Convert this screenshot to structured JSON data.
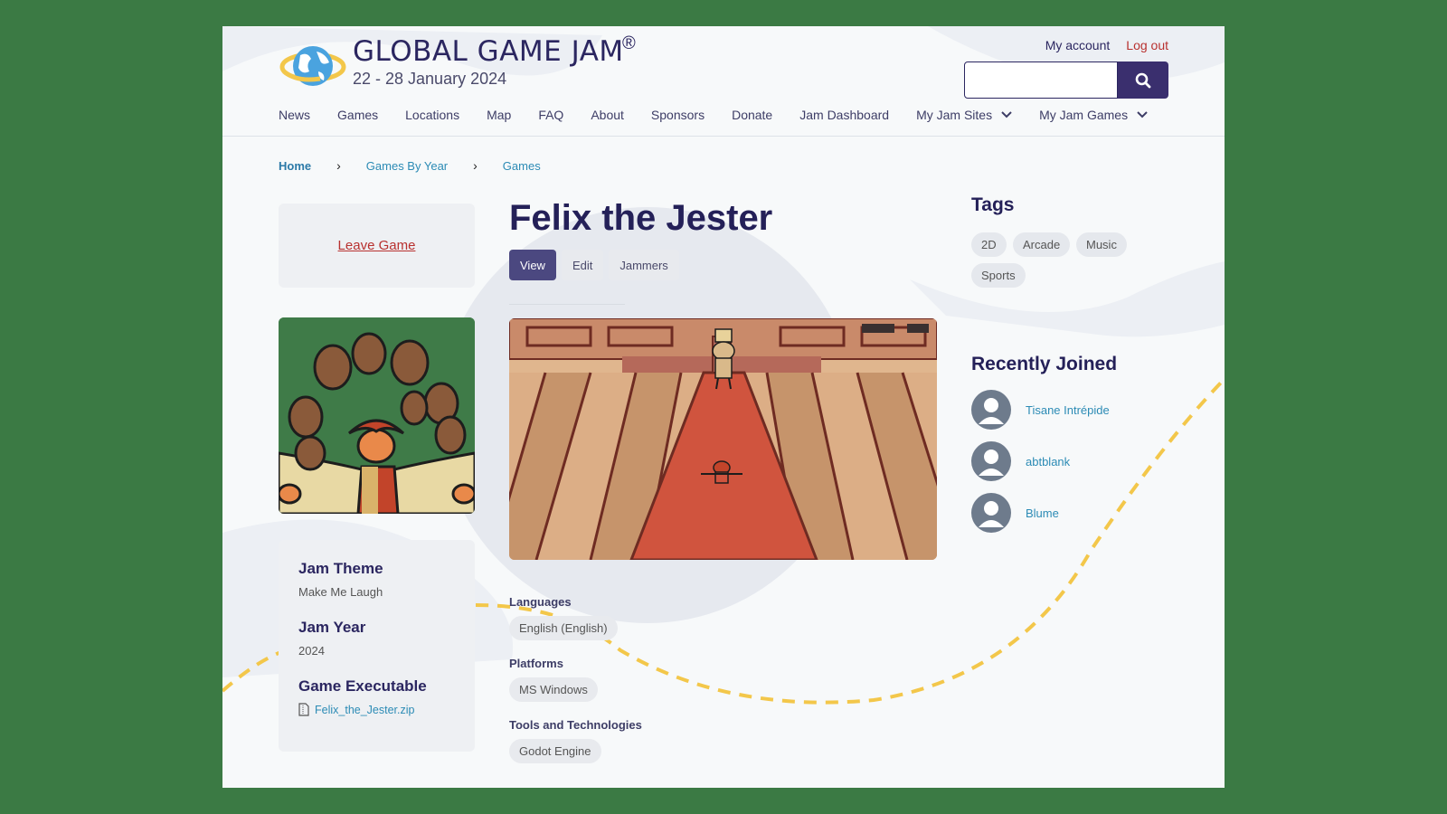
{
  "header": {
    "logo_title": "GLOBAL GAME JAM",
    "logo_reg": "®",
    "logo_dates": "22 - 28 January 2024",
    "my_account": "My account",
    "log_out": "Log out",
    "search_placeholder": "",
    "nav": [
      "News",
      "Games",
      "Locations",
      "Map",
      "FAQ",
      "About",
      "Sponsors",
      "Donate",
      "Jam Dashboard",
      "My Jam Sites",
      "My Jam Games"
    ]
  },
  "breadcrumb": [
    "Home",
    "Games By Year",
    "Games"
  ],
  "leave_game": "Leave Game",
  "game": {
    "title": "Felix the Jester",
    "tabs": [
      "View",
      "Edit",
      "Jammers"
    ],
    "active_tab": "View"
  },
  "info": {
    "jam_theme_label": "Jam Theme",
    "jam_theme_value": "Make Me Laugh",
    "jam_year_label": "Jam Year",
    "jam_year_value": "2024",
    "executable_label": "Game Executable",
    "executable_file": "Felix_the_Jester.zip"
  },
  "meta": {
    "languages_label": "Languages",
    "languages_value": "English (English)",
    "platforms_label": "Platforms",
    "platforms_value": "MS Windows",
    "tools_label": "Tools and Technologies",
    "tools_value": "Godot Engine"
  },
  "tags": {
    "heading": "Tags",
    "items": [
      "2D",
      "Arcade",
      "Music",
      "Sports"
    ]
  },
  "recent": {
    "heading": "Recently Joined",
    "members": [
      "Tisane Intrépide",
      "abtblank",
      "Blume"
    ]
  },
  "colors": {
    "accent": "#3a2f6e",
    "link": "#2c8bb5",
    "danger": "#b8312f",
    "frame": "#3b7a44"
  }
}
